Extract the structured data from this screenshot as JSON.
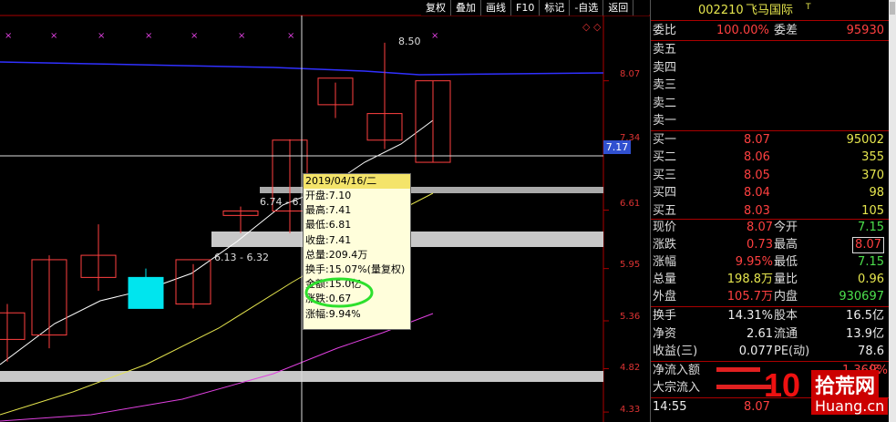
{
  "toolbar": {
    "items": [
      "复权",
      "叠加",
      "画线",
      "F10",
      "标记",
      "-自选",
      "返回"
    ]
  },
  "stock": {
    "code": "002210",
    "name": "飞马国际",
    "flag": "T"
  },
  "axis": {
    "ticks": [
      "8.07",
      "7.34",
      "6.61",
      "5.95",
      "5.36",
      "4.82",
      "4.33"
    ],
    "current_marker": "7.17"
  },
  "annotations": {
    "high": "8.50",
    "range1": "6.74 - 6.",
    "range2": "6.13 - 6.32"
  },
  "tooltip": {
    "date": "2019/04/16/二",
    "rows": [
      "开盘:7.10",
      "最高:7.41",
      "最低:6.81",
      "收盘:7.41",
      "总量:209.4万",
      "换手:15.07%(量复权)",
      "金额:15.0亿",
      "涨跌:0.67",
      "涨幅:9.94%"
    ]
  },
  "quote": {
    "weibi_label": "委比",
    "weibi": "100.00%",
    "weicha_label": "委差",
    "weicha": "95930",
    "sell": [
      {
        "label": "卖五",
        "price": "",
        "vol": ""
      },
      {
        "label": "卖四",
        "price": "",
        "vol": ""
      },
      {
        "label": "卖三",
        "price": "",
        "vol": ""
      },
      {
        "label": "卖二",
        "price": "",
        "vol": ""
      },
      {
        "label": "卖一",
        "price": "",
        "vol": ""
      }
    ],
    "buy": [
      {
        "label": "买一",
        "price": "8.07",
        "vol": "95002"
      },
      {
        "label": "买二",
        "price": "8.06",
        "vol": "355"
      },
      {
        "label": "买三",
        "price": "8.05",
        "vol": "370"
      },
      {
        "label": "买四",
        "price": "8.04",
        "vol": "98"
      },
      {
        "label": "买五",
        "price": "8.03",
        "vol": "105"
      }
    ],
    "stats": [
      {
        "l1": "现价",
        "v1": "8.07",
        "l2": "今开",
        "v2": "7.15"
      },
      {
        "l1": "涨跌",
        "v1": "0.73",
        "l2": "最高",
        "v2": "8.07"
      },
      {
        "l1": "涨幅",
        "v1": "9.95%",
        "l2": "最低",
        "v2": "7.15"
      },
      {
        "l1": "总量",
        "v1": "198.8万",
        "l2": "量比",
        "v2": "0.96"
      },
      {
        "l1": "外盘",
        "v1": "105.7万",
        "l2": "内盘",
        "v2": "930697"
      }
    ],
    "fund": [
      {
        "l1": "换手",
        "v1": "14.31%",
        "l2": "股本",
        "v2": "16.5亿"
      },
      {
        "l1": "净资",
        "v1": "2.61",
        "l2": "流通",
        "v2": "13.9亿"
      },
      {
        "l1": "收益(三)",
        "v1": "0.077",
        "l2": "PE(动)",
        "v2": "78.6"
      }
    ],
    "flows": [
      {
        "label": "净流入额",
        "value": "1.36亿",
        "pct": "9%"
      },
      {
        "label": "大宗流入",
        "value": "",
        "pct": ""
      }
    ],
    "tick": {
      "time": "14:55",
      "price": "8.07"
    }
  },
  "watermark": {
    "text": "拾荒网",
    "sub": "Huang.cn",
    "num": "10"
  },
  "colors": {
    "up": "#ff4040",
    "down": "#00e5ee",
    "ma5": "#ffffff",
    "ma10": "#e6e64e",
    "ma20": "#e040e0",
    "ma60": "#3a3aff"
  },
  "chart_data": {
    "type": "candlestick",
    "candles": [
      {
        "open": 5.15,
        "high": 5.55,
        "low": 4.9,
        "close": 5.45
      },
      {
        "open": 5.2,
        "high": 6.1,
        "low": 5.05,
        "close": 6.05
      },
      {
        "open": 5.85,
        "high": 6.45,
        "low": 5.7,
        "close": 6.1
      },
      {
        "open": 5.85,
        "high": 5.95,
        "low": 5.5,
        "close": 5.5
      },
      {
        "open": 5.55,
        "high": 6.0,
        "low": 5.5,
        "close": 6.05
      },
      {
        "open": 6.55,
        "high": 6.65,
        "low": 6.35,
        "close": 6.6
      },
      {
        "open": 6.6,
        "high": 7.41,
        "low": 6.35,
        "close": 7.4
      },
      {
        "open": 7.8,
        "high": 8.05,
        "low": 7.65,
        "close": 8.1
      },
      {
        "open": 7.4,
        "high": 8.5,
        "low": 7.3,
        "close": 7.7
      },
      {
        "open": 7.15,
        "high": 8.07,
        "low": 7.15,
        "close": 8.07
      }
    ],
    "ylim": [
      4.3,
      8.55
    ]
  }
}
